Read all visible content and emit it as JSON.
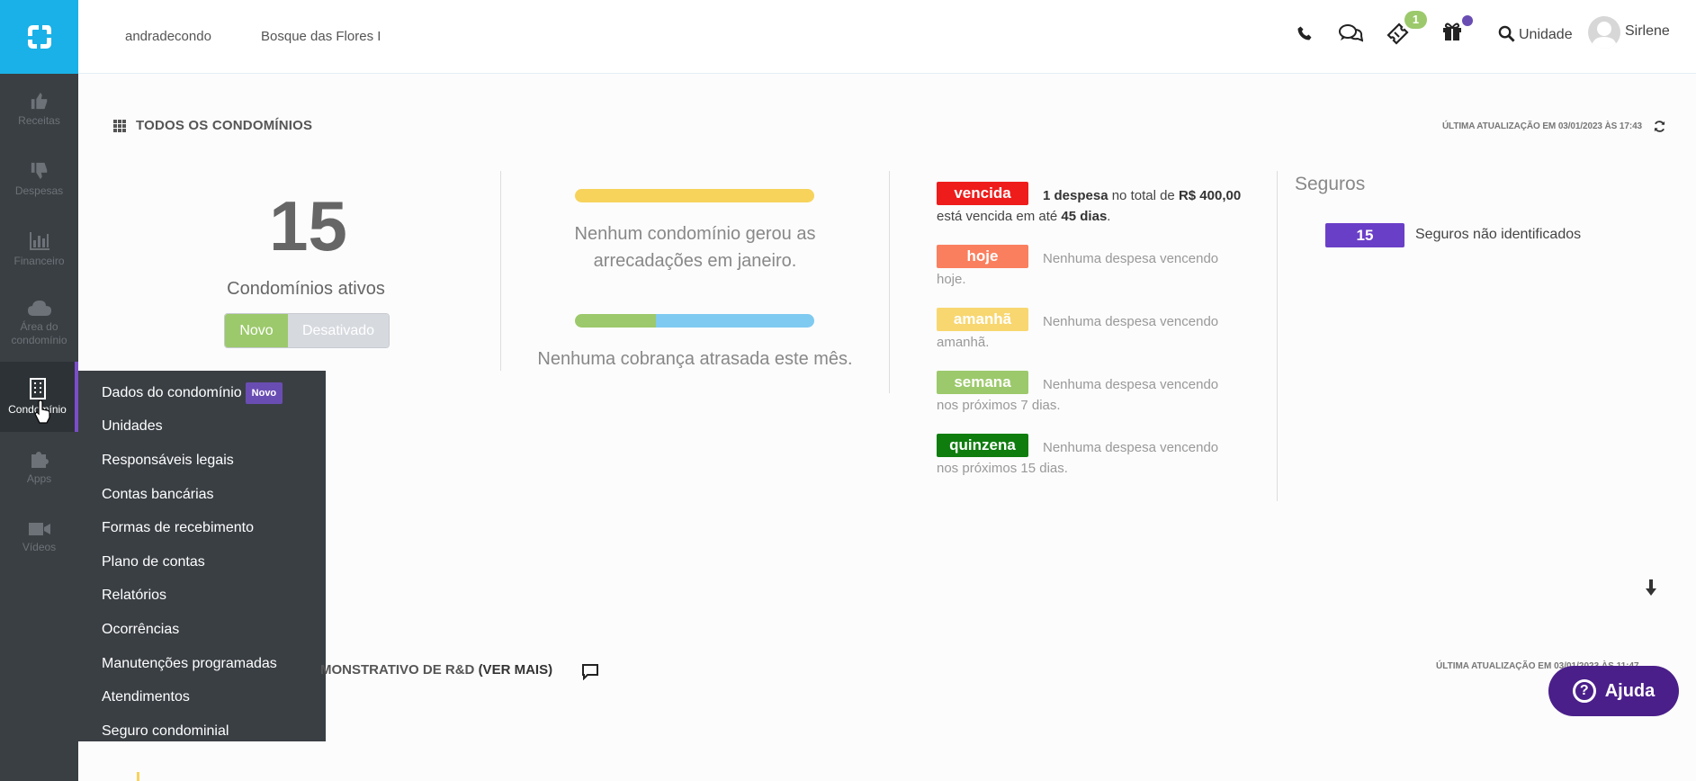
{
  "sidebar": {
    "items": [
      {
        "label": "Receitas",
        "icon": "thumbs-up-icon"
      },
      {
        "label": "Despesas",
        "icon": "thumbs-down-icon"
      },
      {
        "label": "Financeiro",
        "icon": "bar-chart-icon"
      },
      {
        "label": "Área do condomínio",
        "icon": "cloud-icon"
      },
      {
        "label": "Condomínio",
        "icon": "building-icon"
      },
      {
        "label": "Apps",
        "icon": "puzzle-icon"
      },
      {
        "label": "Vídeos",
        "icon": "video-camera-icon"
      }
    ]
  },
  "header": {
    "crumb1": "andradecondo",
    "crumb2": "Bosque das Flores I",
    "tickets_badge": "1",
    "search_label": "Unidade",
    "user_name": "Sirlene"
  },
  "section1": {
    "title": "TODOS OS CONDOMÍNIOS",
    "updated": "ÚLTIMA ATUALIZAÇÃO EM 03/01/2023 ÀS 17:43"
  },
  "stats": {
    "active_count": "15",
    "active_label": "Condomínios ativos",
    "toggle_on": "Novo",
    "toggle_off": "Desativado"
  },
  "collections": {
    "text1": "Nenhum condomínio gerou as arrecadações em janeiro.",
    "text2": "Nenhuma cobrança atrasada este mês.",
    "colors": {
      "yellow": "#f7d35c",
      "green": "#9cc96b",
      "blue": "#7fcaf1"
    }
  },
  "expenses": {
    "vencida": {
      "tag": "vencida",
      "bold1": "1 despesa",
      "mid1": " no total de ",
      "bold2": "R$ 400,00",
      "mid2": " está vencida em até ",
      "bold3": "45 dias",
      "end": ".",
      "color": "#ef1c1c"
    },
    "hoje": {
      "tag": "hoje",
      "text": "Nenhuma despesa vencendo hoje.",
      "color": "#fa7f5e"
    },
    "amanha": {
      "tag": "amanhã",
      "text": "Nenhuma despesa vencendo amanhã.",
      "color": "#f8d770"
    },
    "semana": {
      "tag": "semana",
      "text": "Nenhuma despesa vencendo nos próximos 7 dias.",
      "color": "#9cc96b"
    },
    "quinzena": {
      "tag": "quinzena",
      "text": "Nenhuma despesa vencendo nos próximos 15 dias.",
      "color": "#0e7d0e"
    }
  },
  "seguros": {
    "title": "Seguros",
    "count": "15",
    "label": "Seguros não identificados"
  },
  "dropdown": {
    "items": [
      "Dados do condomínio",
      "Unidades",
      "Responsáveis legais",
      "Contas bancárias",
      "Formas de recebimento",
      "Plano de contas",
      "Relatórios",
      "Ocorrências",
      "Manutenções programadas",
      "Atendimentos",
      "Seguro condominial"
    ],
    "new_badge": "Novo"
  },
  "section2": {
    "title": "MONSTRATIVO DE R&D",
    "ver_mais": "(VER MAIS)",
    "updated": "ÚLTIMA ATUALIZAÇÃO EM 03/01/2023 ÀS 11:47"
  },
  "help": {
    "label": "Ajuda"
  }
}
